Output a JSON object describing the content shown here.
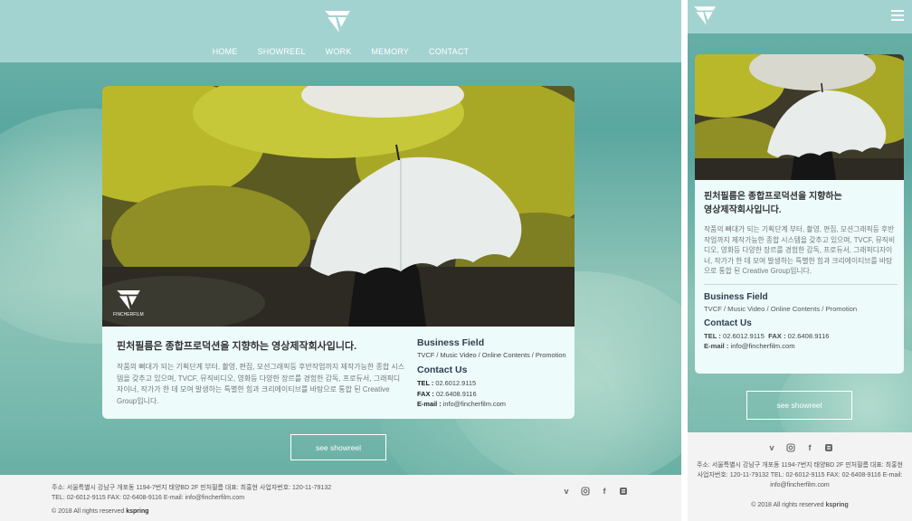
{
  "brand": {
    "logo_text": "FINCHERFILM"
  },
  "nav": {
    "items": [
      "HOME",
      "SHOWREEL",
      "WORK",
      "MEMORY",
      "CONTACT"
    ]
  },
  "about": {
    "title": "핀처필름은 종합프로덕션을 지향하는 영상제작회사입니다.",
    "title_mobile_line1": "핀처필름은 종합프로덕션을 지향하는",
    "title_mobile_line2": "영상제작회사입니다.",
    "body": "작품의 뼈대가 되는 기획단계 부터, 촬영, 편집, 모션그래픽등 후반작업까지 제작가능한 종합 시스템을 갖추고 있으며, TVCF, 뮤직비디오, 영화등 다양한 장르를 경험한 감독, 프로듀서, 그래픽디자이너, 작가가 한 데 모여 발생하는 특별한 힘과 크리에이티브를 바탕으로 통합 된 Creative Group입니다."
  },
  "business": {
    "title": "Business Field",
    "text": "TVCF / Music Video / Online Contents / Promotion"
  },
  "contact": {
    "title": "Contact Us",
    "tel_label": "TEL :",
    "tel": "02.6012.9115",
    "fax_label": "FAX :",
    "fax": "02.6408.9116",
    "email_label": "E-mail :",
    "email": "info@fincherfilm.com"
  },
  "cta": {
    "label": "see showreel"
  },
  "footer": {
    "line1": "주소: 서울특별시 강남구 개포동 1194-7번지 태양BD 2F 핀처필름   대표: 최홍현   사업자번호: 120-11-79132",
    "line2": "TEL: 02-6012-9115   FAX: 02-6408-9116   E-mail: info@fincherfilm.com",
    "copyright": "© 2018 All rights reserved",
    "copyright_brand": "kspring",
    "mobile_text": "주소: 서울특별시 강남구 개포동 1194-7번지 태양BD 2F 핀처필름   대표: 최홍현   사업자번호: 120-11-79132 TEL: 02-6012-9115   FAX: 02-6408-9116   E-mail: info@fincherfilm.com",
    "social_icons": [
      "vimeo-icon",
      "instagram-icon",
      "facebook-icon",
      "blog-icon"
    ]
  }
}
